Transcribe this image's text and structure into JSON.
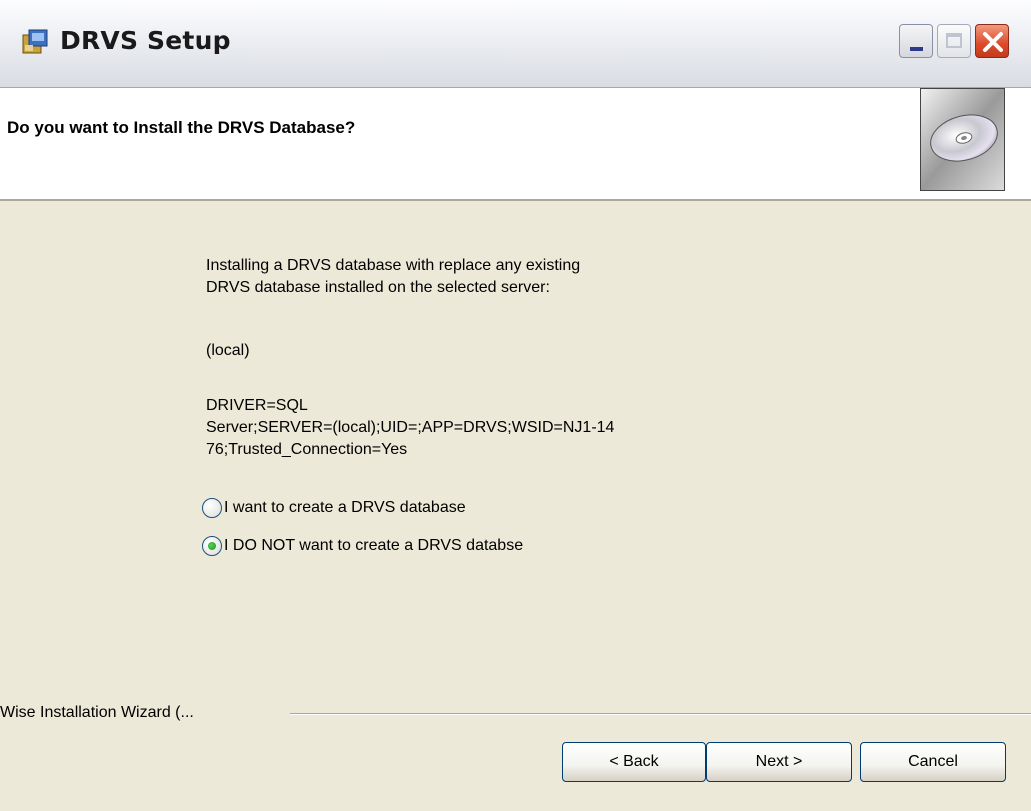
{
  "window": {
    "title": "DRVS Setup",
    "icon": "installer-icon"
  },
  "banner": {
    "title": "Do you want to Install the DRVS Database?",
    "icon": "cd-disc-icon"
  },
  "body": {
    "intro_line1": "Installing a DRVS database with replace any existing",
    "intro_line2": "DRVS database installed on the selected server:",
    "server": "(local)",
    "conn_line1": "DRIVER=SQL",
    "conn_line2": "Server;SERVER=(local);UID=;APP=DRVS;WSID=NJ1-14",
    "conn_line3": "76;Trusted_Connection=Yes"
  },
  "options": [
    {
      "label": "I want to create a DRVS database",
      "selected": false
    },
    {
      "label": "I DO NOT want to create a DRVS databse",
      "selected": true
    }
  ],
  "footer": {
    "group_label": "Wise Installation Wizard (...",
    "back_label": "< Back",
    "next_label": "Next >",
    "cancel_label": "Cancel"
  }
}
